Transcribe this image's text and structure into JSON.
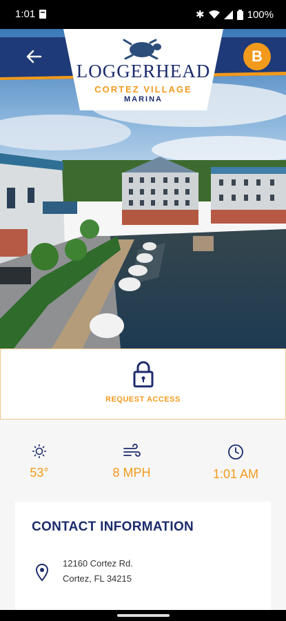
{
  "status_bar": {
    "time": "1:01",
    "battery": "100%"
  },
  "header": {
    "logo_line1": "LOGGERHEAD",
    "logo_line2": "CORTEZ VILLAGE",
    "logo_line3": "MARINA",
    "avatar_initial": "B"
  },
  "access": {
    "label": "REQUEST ACCESS"
  },
  "weather": {
    "temperature": "53°",
    "wind": "8 MPH",
    "time": "1:01 AM"
  },
  "contact": {
    "title": "CONTACT INFORMATION",
    "address_line1": "12160 Cortez Rd.",
    "address_line2": "Cortez, FL 34215"
  },
  "colors": {
    "navy": "#1b2b6b",
    "orange": "#f29a1c"
  }
}
